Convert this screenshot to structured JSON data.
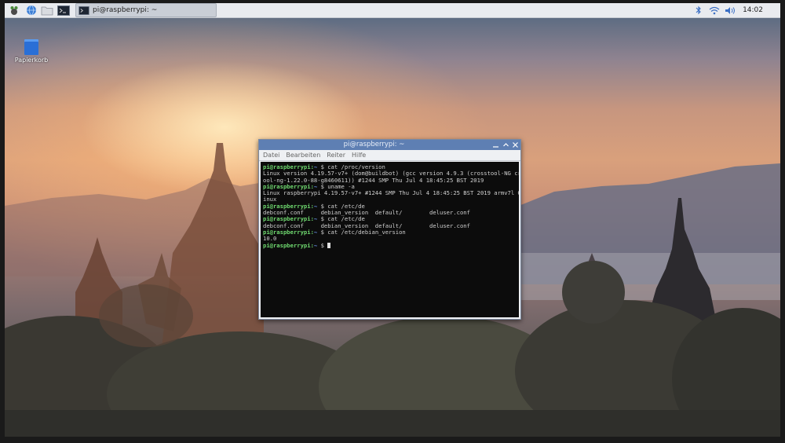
{
  "panel": {
    "task_label": "pi@raspberrypi: ~",
    "clock": "14:02"
  },
  "desktop": {
    "trash_label": "Papierkorb"
  },
  "terminal": {
    "title": "pi@raspberrypi: ~",
    "menu": [
      "Datei",
      "Bearbeiten",
      "Reiter",
      "Hilfe"
    ],
    "lines": [
      {
        "prompt": "pi@raspberrypi",
        "path": "~",
        "cmd": "cat /proc/version"
      },
      {
        "text": "Linux version 4.19.57-v7+ (dom@buildbot) (gcc version 4.9.3 (crosstool-NG crosst"
      },
      {
        "text": "ool-ng-1.22.0-88-g8460611)) #1244 SMP Thu Jul 4 18:45:25 BST 2019"
      },
      {
        "prompt": "pi@raspberrypi",
        "path": "~",
        "cmd": "uname -a"
      },
      {
        "text": "Linux raspberrypi 4.19.57-v7+ #1244 SMP Thu Jul 4 18:45:25 BST 2019 armv7l GNU/L"
      },
      {
        "text": "inux"
      },
      {
        "prompt": "pi@raspberrypi",
        "path": "~",
        "cmd": "cat /etc/de"
      },
      {
        "text": "debconf.conf     debian_version  default/        deluser.conf"
      },
      {
        "prompt": "pi@raspberrypi",
        "path": "~",
        "cmd": "cat /etc/de"
      },
      {
        "text": "debconf.conf     debian_version  default/        deluser.conf"
      },
      {
        "prompt": "pi@raspberrypi",
        "path": "~",
        "cmd": "cat /etc/debian_version"
      },
      {
        "text": "10.0"
      },
      {
        "prompt": "pi@raspberrypi",
        "path": "~",
        "cmd": "",
        "cursor": true
      }
    ]
  },
  "icons": {
    "menu": "raspberry-icon",
    "browser": "globe-icon",
    "files": "folder-icon",
    "terminal": "terminal-icon",
    "bluetooth": "bluetooth-icon",
    "wifi": "wifi-icon",
    "volume": "volume-icon"
  },
  "colors": {
    "panel": "#e9ebef",
    "titlebar": "#5e7fb3",
    "prompt": "#6fd86f",
    "path": "#6f9cf5"
  }
}
